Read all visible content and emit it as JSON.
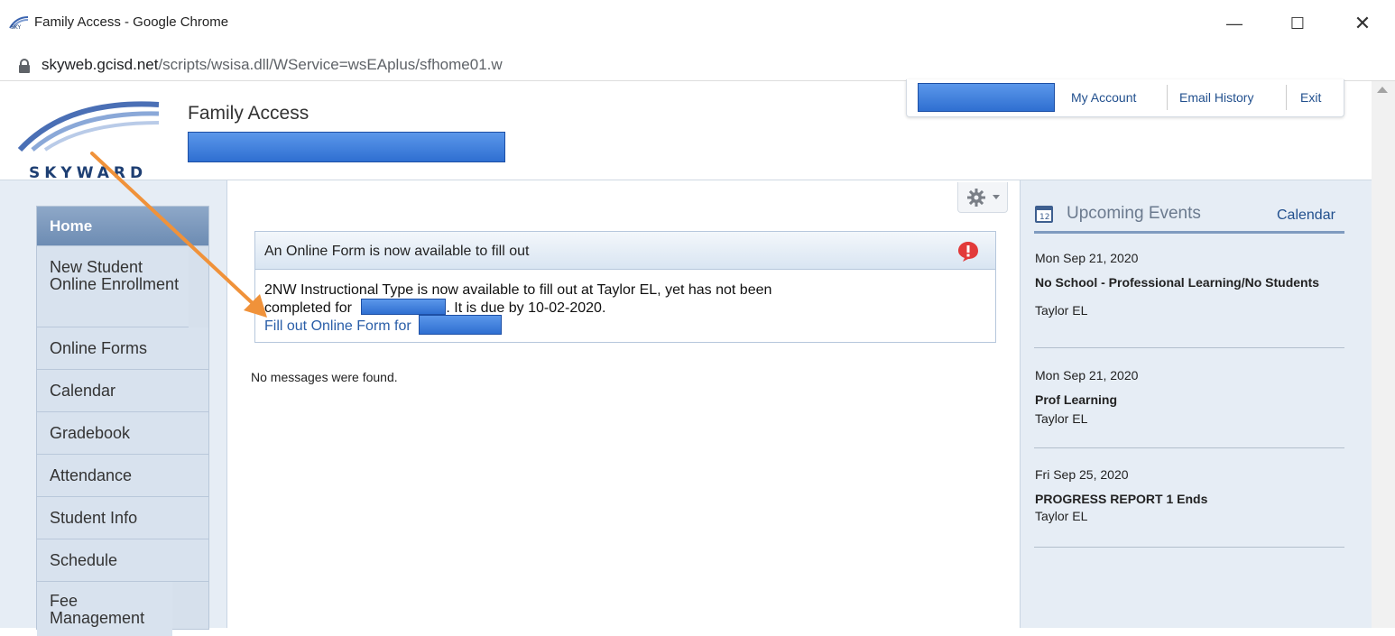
{
  "window": {
    "title": "Family Access - Google Chrome",
    "minimize": "—",
    "maximize": "☐",
    "close": "✕"
  },
  "address": {
    "host": "skyweb.gcisd.net",
    "path": "/scripts/wsisa.dll/WService=wsEAplus/sfhome01.w"
  },
  "header": {
    "logo_text": "SKYWARD",
    "app_name": "Family Access",
    "top_nav": [
      "My Account",
      "Email History",
      "Exit"
    ]
  },
  "sidebar": {
    "items": [
      {
        "label": "Home",
        "active": true
      },
      {
        "label": "New Student Online Enrollment"
      },
      {
        "label": "Online Forms"
      },
      {
        "label": "Calendar"
      },
      {
        "label": "Gradebook"
      },
      {
        "label": "Attendance"
      },
      {
        "label": "Student Info"
      },
      {
        "label": "Schedule"
      },
      {
        "label": "Fee Management"
      }
    ]
  },
  "notice": {
    "title": "An Online Form is now available to fill out",
    "line1": "2NW Instructional Type is now available to fill out at Taylor EL, yet has not been",
    "line2_pre": "completed for",
    "line2_post": ".  It is due by 10-02-2020.",
    "link": "Fill out Online Form for"
  },
  "messages": {
    "empty": "No messages were found."
  },
  "events": {
    "title": "Upcoming Events",
    "calendar_link": "Calendar",
    "items": [
      {
        "date": "Mon Sep 21, 2020",
        "name": "No School - Professional Learning/No Students",
        "location": "Taylor EL"
      },
      {
        "date": "Mon Sep 21, 2020",
        "name": "Prof Learning",
        "location": "Taylor EL"
      },
      {
        "date": "Fri Sep 25, 2020",
        "name": "PROGRESS REPORT 1 Ends",
        "location": "Taylor EL"
      }
    ]
  },
  "colors": {
    "accent": "#22508e",
    "redaction": "#3b7be0",
    "annotation_arrow": "#f0923a"
  }
}
